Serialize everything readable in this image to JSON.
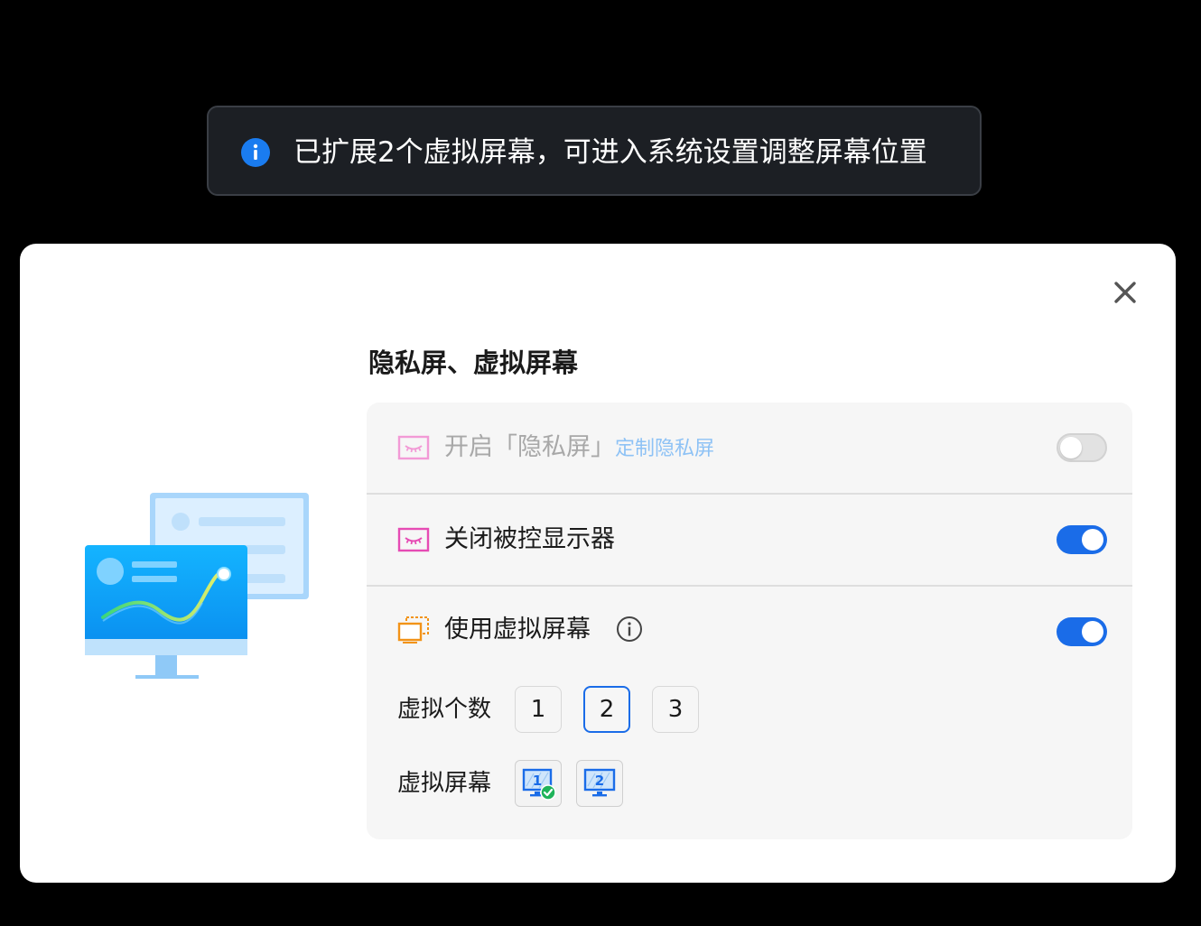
{
  "toast": {
    "icon": "info-icon",
    "message": "已扩展2个虚拟屏幕，可进入系统设置调整屏幕位置"
  },
  "dialog": {
    "title": "隐私屏、虚拟屏幕",
    "close_icon": "close-icon",
    "illustration": "virtual-display-illustration",
    "rows": [
      {
        "icon": "privacy-screen-icon",
        "label": "开启「隐私屏」",
        "link": "定制隐私屏",
        "enabled": false,
        "toggle": "off"
      },
      {
        "icon": "privacy-screen-icon",
        "label": "关闭被控显示器",
        "toggle": "on"
      },
      {
        "icon": "virtual-screen-icon",
        "label": "使用虚拟屏幕",
        "info_icon": "info-circle-icon",
        "toggle": "on"
      }
    ],
    "virtual_count": {
      "label": "虚拟个数",
      "options": [
        "1",
        "2",
        "3"
      ],
      "selected": "2"
    },
    "virtual_screens": {
      "label": "虚拟屏幕",
      "screens": [
        {
          "number": "1",
          "checked": true
        },
        {
          "number": "2",
          "checked": false
        }
      ]
    }
  },
  "colors": {
    "accent": "#1a6ce8",
    "toast_bg": "#1c1f24",
    "icon_pink": "#e64bb4",
    "icon_orange": "#f29318",
    "check_green": "#1fb35a",
    "link": "#8ec2f5"
  }
}
